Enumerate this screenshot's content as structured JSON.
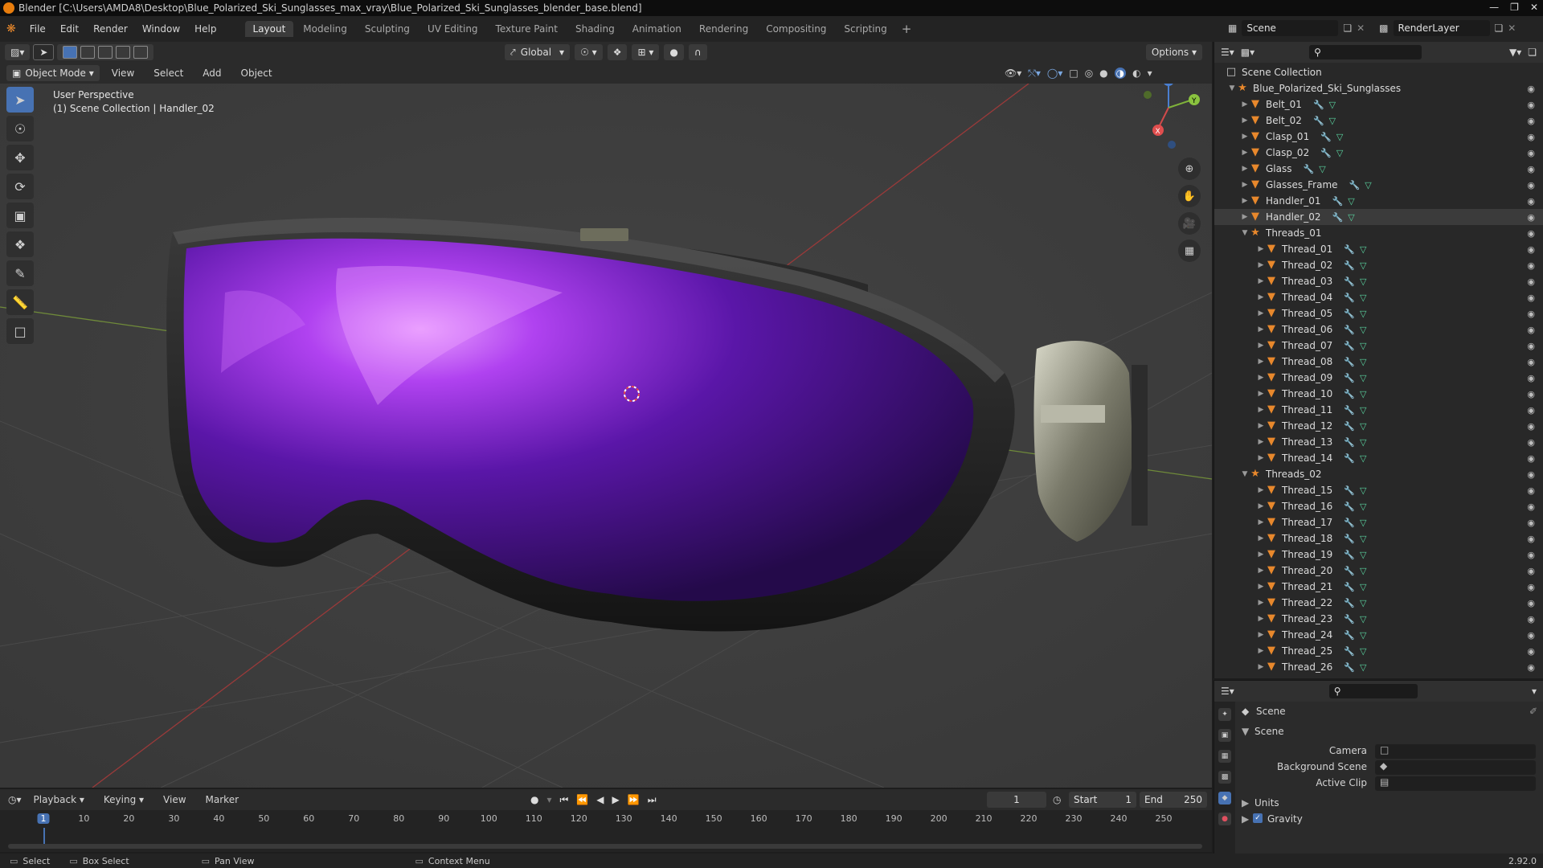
{
  "window": {
    "title": "Blender [C:\\Users\\AMDA8\\Desktop\\Blue_Polarized_Ski_Sunglasses_max_vray\\Blue_Polarized_Ski_Sunglasses_blender_base.blend]"
  },
  "menu": [
    "File",
    "Edit",
    "Render",
    "Window",
    "Help"
  ],
  "workspaces": [
    "Layout",
    "Modeling",
    "Sculpting",
    "UV Editing",
    "Texture Paint",
    "Shading",
    "Animation",
    "Rendering",
    "Compositing",
    "Scripting"
  ],
  "active_workspace": "Layout",
  "scene_selector": {
    "value": "Scene"
  },
  "renderlayer_selector": {
    "value": "RenderLayer"
  },
  "viewport_header": {
    "transform_orientation": "Global",
    "options_label": "Options",
    "mode": "Object Mode",
    "menus": [
      "View",
      "Select",
      "Add",
      "Object"
    ]
  },
  "viewport": {
    "perspective_label": "User Perspective",
    "context_label": "(1) Scene Collection | Handler_02",
    "gizmo_labels": {
      "z": "Z",
      "y": "Y",
      "x": "X"
    }
  },
  "outliner": {
    "root": "Scene Collection",
    "collection": "Blue_Polarized_Ski_Sunglasses",
    "items": [
      "Belt_01",
      "Belt_02",
      "Clasp_01",
      "Clasp_02",
      "Glass",
      "Glasses_Frame",
      "Handler_01",
      "Handler_02"
    ],
    "selected": "Handler_02",
    "group1": {
      "name": "Threads_01",
      "children": [
        "Thread_01",
        "Thread_02",
        "Thread_03",
        "Thread_04",
        "Thread_05",
        "Thread_06",
        "Thread_07",
        "Thread_08",
        "Thread_09",
        "Thread_10",
        "Thread_11",
        "Thread_12",
        "Thread_13",
        "Thread_14"
      ]
    },
    "group2": {
      "name": "Threads_02",
      "children": [
        "Thread_15",
        "Thread_16",
        "Thread_17",
        "Thread_18",
        "Thread_19",
        "Thread_20",
        "Thread_21",
        "Thread_22",
        "Thread_23",
        "Thread_24",
        "Thread_25",
        "Thread_26"
      ]
    }
  },
  "properties": {
    "context": "Scene",
    "panel": "Scene",
    "camera_label": "Camera",
    "background_scene_label": "Background Scene",
    "active_clip_label": "Active Clip",
    "units_label": "Units",
    "gravity_label": "Gravity"
  },
  "timeline": {
    "menus": [
      "Playback",
      "Keying",
      "View",
      "Marker"
    ],
    "current_frame": "1",
    "start_label": "Start",
    "start_value": "1",
    "end_label": "End",
    "end_value": "250",
    "ticks": [
      "1",
      "10",
      "20",
      "30",
      "40",
      "50",
      "60",
      "70",
      "80",
      "90",
      "100",
      "110",
      "120",
      "130",
      "140",
      "150",
      "160",
      "170",
      "180",
      "190",
      "200",
      "210",
      "220",
      "230",
      "240",
      "250"
    ]
  },
  "statusbar": {
    "select": "Select",
    "box_select": "Box Select",
    "pan_view": "Pan View",
    "context_menu": "Context Menu",
    "version": "2.92.0"
  },
  "colors": {
    "accent": "#4772b3",
    "lens": "#7a1fd6",
    "object_icon": "#e8882c"
  }
}
